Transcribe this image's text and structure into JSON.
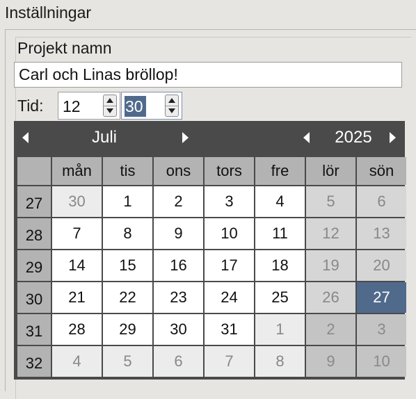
{
  "header": {
    "title": "Inställningar"
  },
  "project": {
    "label": "Projekt namn",
    "value": "Carl och Linas bröllop!"
  },
  "time": {
    "label": "Tid:",
    "hour": "12",
    "minute": "30"
  },
  "calendar": {
    "month": "Juli",
    "year": "2025",
    "weekdays": [
      "mån",
      "tis",
      "ons",
      "tors",
      "fre",
      "lör",
      "sön"
    ],
    "weeks": [
      {
        "number": "27",
        "days": [
          {
            "d": "30",
            "other": true
          },
          {
            "d": "1"
          },
          {
            "d": "2"
          },
          {
            "d": "3"
          },
          {
            "d": "4"
          },
          {
            "d": "5"
          },
          {
            "d": "6"
          }
        ]
      },
      {
        "number": "28",
        "days": [
          {
            "d": "7"
          },
          {
            "d": "8"
          },
          {
            "d": "9"
          },
          {
            "d": "10"
          },
          {
            "d": "11"
          },
          {
            "d": "12"
          },
          {
            "d": "13"
          }
        ]
      },
      {
        "number": "29",
        "days": [
          {
            "d": "14"
          },
          {
            "d": "15"
          },
          {
            "d": "16"
          },
          {
            "d": "17"
          },
          {
            "d": "18"
          },
          {
            "d": "19"
          },
          {
            "d": "20"
          }
        ]
      },
      {
        "number": "30",
        "days": [
          {
            "d": "21"
          },
          {
            "d": "22"
          },
          {
            "d": "23"
          },
          {
            "d": "24"
          },
          {
            "d": "25"
          },
          {
            "d": "26"
          },
          {
            "d": "27",
            "selected": true
          }
        ]
      },
      {
        "number": "31",
        "days": [
          {
            "d": "28"
          },
          {
            "d": "29"
          },
          {
            "d": "30"
          },
          {
            "d": "31"
          },
          {
            "d": "1",
            "other": true
          },
          {
            "d": "2",
            "other": true
          },
          {
            "d": "3",
            "other": true
          }
        ]
      },
      {
        "number": "32",
        "days": [
          {
            "d": "4",
            "other": true
          },
          {
            "d": "5",
            "other": true
          },
          {
            "d": "6",
            "other": true
          },
          {
            "d": "7",
            "other": true
          },
          {
            "d": "8",
            "other": true
          },
          {
            "d": "9",
            "other": true
          },
          {
            "d": "10",
            "other": true
          }
        ]
      }
    ]
  },
  "colors": {
    "accent": "#506a8c",
    "calendar_bg": "#4a4a4a"
  }
}
